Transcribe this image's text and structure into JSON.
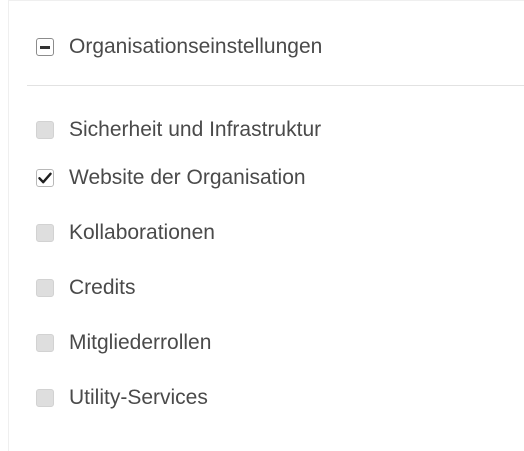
{
  "group": {
    "label": "Organisationseinstellungen",
    "state": "indeterminate"
  },
  "options": [
    {
      "label": "Sicherheit und Infrastruktur",
      "checked": false
    },
    {
      "label": "Website der Organisation",
      "checked": true
    },
    {
      "label": "Kollaborationen",
      "checked": false
    },
    {
      "label": "Credits",
      "checked": false
    },
    {
      "label": "Mitgliederrollen",
      "checked": false
    },
    {
      "label": "Utility-Services",
      "checked": false
    }
  ]
}
